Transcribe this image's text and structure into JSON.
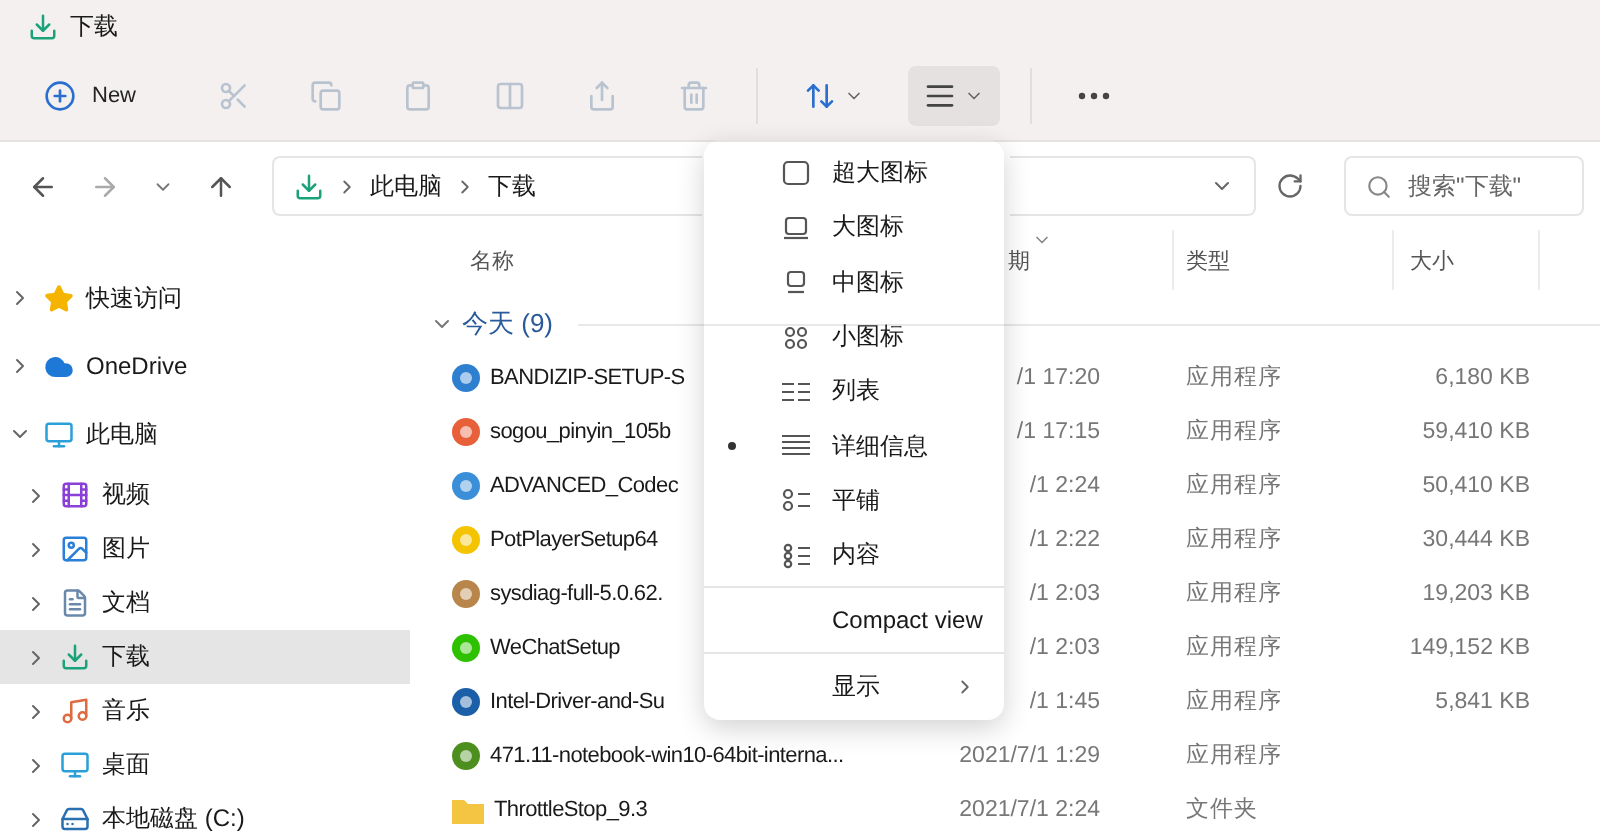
{
  "window": {
    "title": "下载"
  },
  "toolbar": {
    "new_button": {
      "label": "New"
    },
    "items": [
      {
        "kind": "cut",
        "disabled": true
      },
      {
        "kind": "copy",
        "disabled": true
      },
      {
        "kind": "paste",
        "disabled": true
      },
      {
        "kind": "rename",
        "disabled": true
      },
      {
        "kind": "share",
        "disabled": true
      },
      {
        "kind": "delete",
        "disabled": true
      },
      {
        "kind": "sort",
        "disabled": false,
        "expanded": false
      },
      {
        "kind": "view",
        "disabled": false,
        "expanded": true
      },
      {
        "kind": "more",
        "disabled": false
      }
    ]
  },
  "address": {
    "path": [
      "此电脑",
      "下载"
    ],
    "search": {
      "placeholder": "搜索\"下载\""
    }
  },
  "sidebar": {
    "items": [
      {
        "label": "快速访问",
        "kind": "star",
        "expanded": false,
        "selected": false
      },
      {
        "label": "OneDrive",
        "kind": "cloud",
        "expanded": false,
        "selected": false
      },
      {
        "label": "此电脑",
        "kind": "pc",
        "expanded": true,
        "selected": false,
        "children": [
          {
            "label": "视频",
            "kind": "video",
            "expanded": false,
            "selected": false
          },
          {
            "label": "图片",
            "kind": "picture",
            "expanded": false,
            "selected": false
          },
          {
            "label": "文档",
            "kind": "document",
            "expanded": false,
            "selected": false
          },
          {
            "label": "下载",
            "kind": "download",
            "expanded": false,
            "selected": true
          },
          {
            "label": "音乐",
            "kind": "music",
            "expanded": false,
            "selected": false
          },
          {
            "label": "桌面",
            "kind": "desktop",
            "expanded": false,
            "selected": false
          },
          {
            "label": "本地磁盘 (C:)",
            "kind": "drive",
            "expanded": false,
            "selected": false
          }
        ]
      }
    ]
  },
  "files": {
    "columns": [
      "名称",
      "期",
      "类型",
      "大小"
    ],
    "group": {
      "label": "今天 (9)",
      "expanded": true
    },
    "rows": [
      {
        "name": "BANDIZIP-SETUP-S",
        "date": "/1 17:20",
        "type": "应用程序",
        "size": "6,180 KB",
        "kind": "app",
        "color": "#2f7fd0"
      },
      {
        "name": "sogou_pinyin_105b",
        "date": "/1 17:15",
        "type": "应用程序",
        "size": "59,410 KB",
        "kind": "app",
        "color": "#e8603a"
      },
      {
        "name": "ADVANCED_Codec",
        "date": "/1 2:24",
        "type": "应用程序",
        "size": "50,410 KB",
        "kind": "app",
        "color": "#3a8fd8"
      },
      {
        "name": "PotPlayerSetup64",
        "date": "/1 2:22",
        "type": "应用程序",
        "size": "30,444 KB",
        "kind": "app",
        "color": "#f5c400"
      },
      {
        "name": "sysdiag-full-5.0.62.",
        "date": "/1 2:03",
        "type": "应用程序",
        "size": "19,203 KB",
        "kind": "app",
        "color": "#b8864a"
      },
      {
        "name": "WeChatSetup",
        "date": "/1 2:03",
        "type": "应用程序",
        "size": "149,152 KB",
        "kind": "app",
        "color": "#2dc100"
      },
      {
        "name": "Intel-Driver-and-Su",
        "date": "/1 1:45",
        "type": "应用程序",
        "size": "5,841 KB",
        "kind": "app",
        "color": "#1b5fa8"
      },
      {
        "name": "471.11-notebook-win10-64bit-interna...",
        "date": "2021/7/1 1:29",
        "type": "应用程序",
        "kind": "app",
        "color": "#4c8f1e"
      },
      {
        "name": "ThrottleStop_9.3",
        "date": "2021/7/1 2:24",
        "type": "文件夹",
        "size": "",
        "kind": "folder",
        "color": "#f4c542"
      }
    ]
  },
  "view_menu": {
    "items": [
      {
        "label": "超大图标",
        "kind": "extra-large",
        "selected": false
      },
      {
        "label": "大图标",
        "kind": "large",
        "selected": false
      },
      {
        "label": "中图标",
        "kind": "medium",
        "selected": false
      },
      {
        "label": "小图标",
        "kind": "small",
        "selected": false
      },
      {
        "label": "列表",
        "kind": "list",
        "selected": false
      },
      {
        "label": "详细信息",
        "kind": "details",
        "selected": true
      },
      {
        "label": "平铺",
        "kind": "tiles",
        "selected": false
      },
      {
        "label": "内容",
        "kind": "content",
        "selected": false
      }
    ],
    "compact_view": {
      "label": "Compact view"
    },
    "show": {
      "label": "显示"
    }
  }
}
